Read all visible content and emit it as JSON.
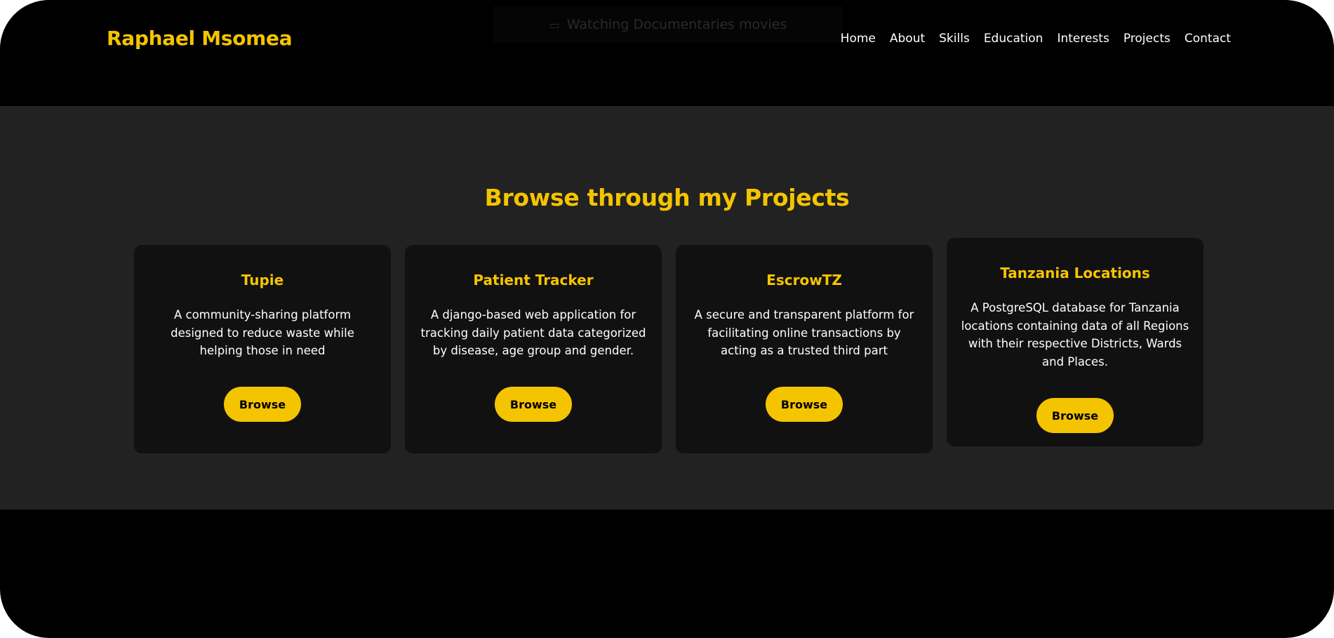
{
  "brand": "Raphael Msomea",
  "banner": {
    "icon": "tv-icon",
    "text": "Watching Documentaries movies"
  },
  "nav": {
    "home": "Home",
    "about": "About",
    "skills": "Skills",
    "education": "Education",
    "interests": "Interests",
    "projects": "Projects",
    "contact": "Contact"
  },
  "projects": {
    "title": "Browse through my Projects",
    "items": [
      {
        "title": "Tupie",
        "description": "A community-sharing platform designed to reduce waste while helping those in need",
        "button": "Browse"
      },
      {
        "title": "Patient Tracker",
        "description": "A django-based web application for tracking daily patient data categorized by disease, age group and gender.",
        "button": "Browse"
      },
      {
        "title": "EscrowTZ",
        "description": "A secure and transparent platform for facilitating online transactions by acting as a trusted third part",
        "button": "Browse"
      },
      {
        "title": "Tanzania Locations",
        "description": "A PostgreSQL database for Tanzania locations containing data of all Regions with their respective Districts, Wards and Places.",
        "button": "Browse"
      }
    ]
  },
  "colors": {
    "accent": "#f5c400",
    "background": "#000000",
    "section": "#222222",
    "card": "#111111"
  }
}
